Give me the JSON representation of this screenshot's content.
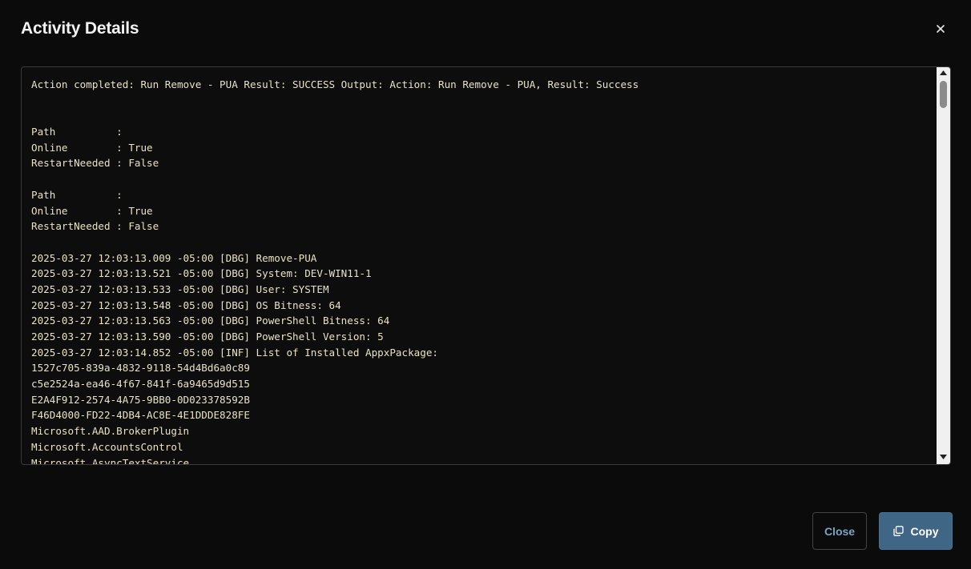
{
  "dialog": {
    "title": "Activity Details",
    "close_icon": "close-icon"
  },
  "log": {
    "lines": [
      "Action completed: Run Remove - PUA Result: SUCCESS Output: Action: Run Remove - PUA, Result: Success",
      "",
      "",
      "Path          :",
      "Online        : True",
      "RestartNeeded : False",
      "",
      "Path          :",
      "Online        : True",
      "RestartNeeded : False",
      "",
      "2025-03-27 12:03:13.009 -05:00 [DBG] Remove-PUA",
      "2025-03-27 12:03:13.521 -05:00 [DBG] System: DEV-WIN11-1",
      "2025-03-27 12:03:13.533 -05:00 [DBG] User: SYSTEM",
      "2025-03-27 12:03:13.548 -05:00 [DBG] OS Bitness: 64",
      "2025-03-27 12:03:13.563 -05:00 [DBG] PowerShell Bitness: 64",
      "2025-03-27 12:03:13.590 -05:00 [DBG] PowerShell Version: 5",
      "2025-03-27 12:03:14.852 -05:00 [INF] List of Installed AppxPackage:",
      "1527c705-839a-4832-9118-54d4Bd6a0c89",
      "c5e2524a-ea46-4f67-841f-6a9465d9d515",
      "E2A4F912-2574-4A75-9BB0-0D023378592B",
      "F46D4000-FD22-4DB4-AC8E-4E1DDDE828FE",
      "Microsoft.AAD.BrokerPlugin",
      "Microsoft.AccountsControl",
      "Microsoft.AsyncTextService"
    ]
  },
  "footer": {
    "close_label": "Close",
    "copy_label": "Copy",
    "copy_icon": "copy-icon"
  },
  "colors": {
    "background": "#0b0b0b",
    "log_text": "#e8e2c8",
    "primary_button": "#3f6685",
    "secondary_button_text": "#7fa3c4"
  }
}
